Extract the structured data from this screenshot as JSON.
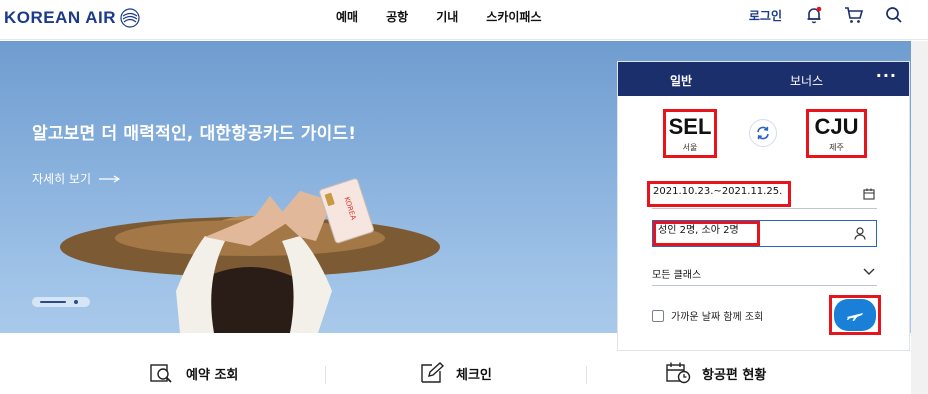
{
  "brand": {
    "name": "KOREAN AIR"
  },
  "nav": {
    "items": [
      "예매",
      "공항",
      "기내",
      "스카이패스"
    ]
  },
  "util": {
    "login": "로그인"
  },
  "hero": {
    "headline": "알고보면 더 매력적인, 대한항공카드 가이드!",
    "more": "자세히 보기",
    "slide_count": 2,
    "card_text": "KOREA"
  },
  "booking": {
    "tabs": [
      "일반",
      "보너스"
    ],
    "more": "···",
    "from": {
      "code": "SEL",
      "city": "서울"
    },
    "to": {
      "code": "CJU",
      "city": "제주"
    },
    "dates": "2021.10.23.~2021.11.25.",
    "passengers": "성인 2명, 소아 2명",
    "class": "모든 클래스",
    "nearby": "가까운 날짜 함께 조회"
  },
  "quick": {
    "items": [
      "예약 조회",
      "체크인",
      "항공편 현황"
    ]
  },
  "colors": {
    "brand_navy": "#1a2f6c",
    "accent_blue": "#1a7fd6",
    "highlight": "#e8141c"
  }
}
